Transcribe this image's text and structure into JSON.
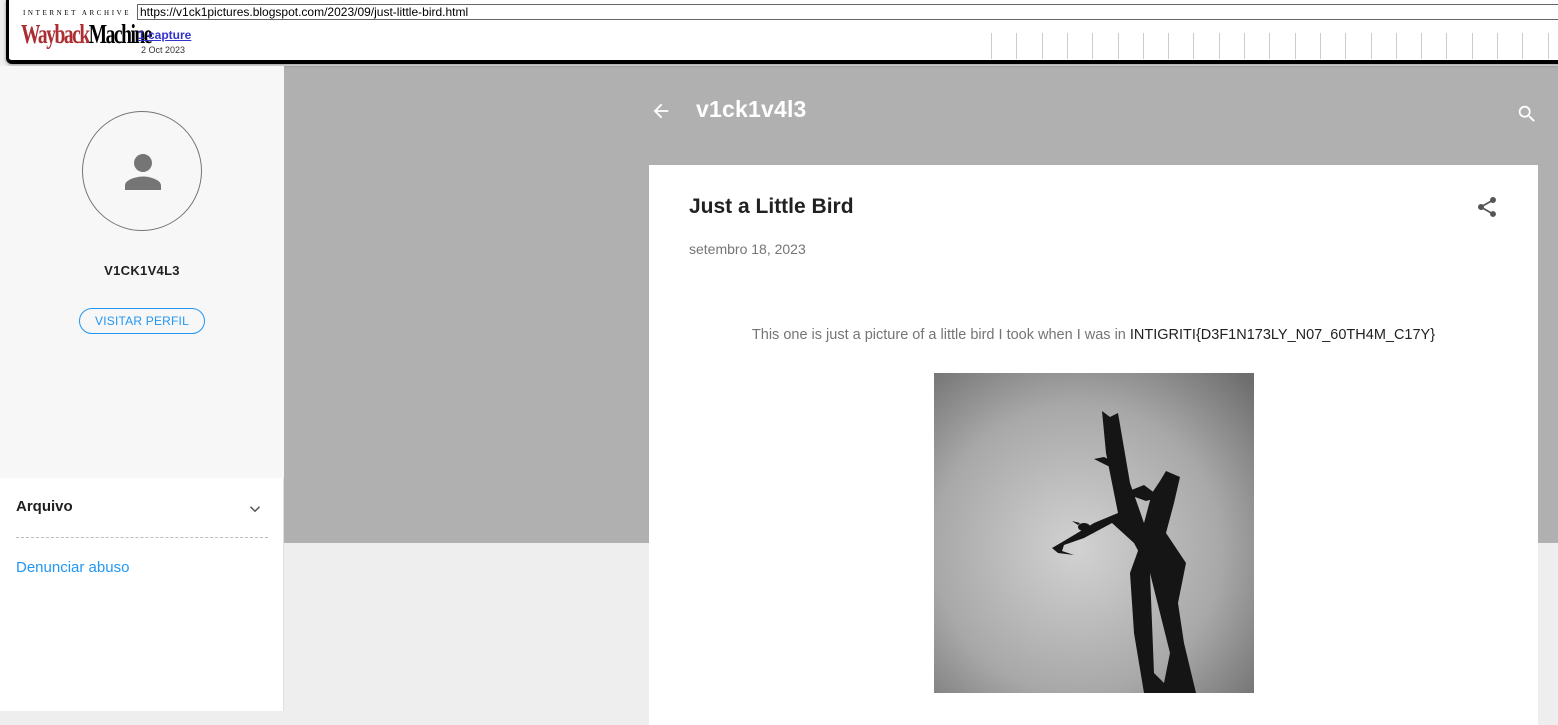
{
  "wayback": {
    "logo_top": "INTERNET ARCHIVE",
    "logo_wayback": "Wayback",
    "logo_machine": "Machine",
    "url": "https://v1ck1pictures.blogspot.com/2023/09/just-little-bird.html",
    "captures": "1 capture",
    "date": "2 Oct 2023"
  },
  "sidebar": {
    "profile_name": "V1CK1V4L3",
    "visit_profile_label": "VISITAR PERFIL",
    "archive_label": "Arquivo",
    "report_abuse_label": "Denunciar abuso"
  },
  "header": {
    "blog_title": "v1ck1v4l3"
  },
  "post": {
    "title": "Just a Little Bird",
    "date": "setembro 18, 2023",
    "body_text": "This one is just a picture of a little bird I took when I was in ",
    "body_flag": "INTIGRITI{D3F1N173LY_N07_60TH4M_C17Y}"
  },
  "colors": {
    "accent": "#2196f3",
    "header_bg": "#b0b0b0",
    "wayback_red": "#ab2e33"
  },
  "icons": {
    "back": "arrow-left-icon",
    "search": "search-icon",
    "share": "share-icon",
    "avatar": "person-icon",
    "chevron": "chevron-down-icon"
  }
}
